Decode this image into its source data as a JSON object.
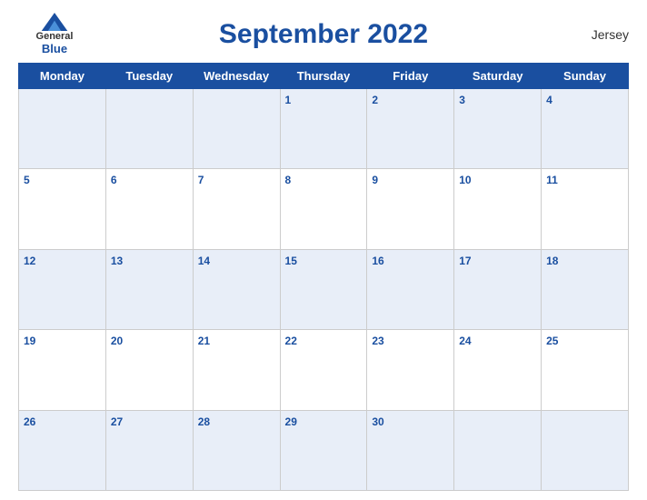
{
  "header": {
    "logo_general": "General",
    "logo_blue": "Blue",
    "title": "September 2022",
    "region": "Jersey"
  },
  "weekdays": [
    "Monday",
    "Tuesday",
    "Wednesday",
    "Thursday",
    "Friday",
    "Saturday",
    "Sunday"
  ],
  "weeks": [
    [
      null,
      null,
      null,
      1,
      2,
      3,
      4
    ],
    [
      5,
      6,
      7,
      8,
      9,
      10,
      11
    ],
    [
      12,
      13,
      14,
      15,
      16,
      17,
      18
    ],
    [
      19,
      20,
      21,
      22,
      23,
      24,
      25
    ],
    [
      26,
      27,
      28,
      29,
      30,
      null,
      null
    ]
  ]
}
